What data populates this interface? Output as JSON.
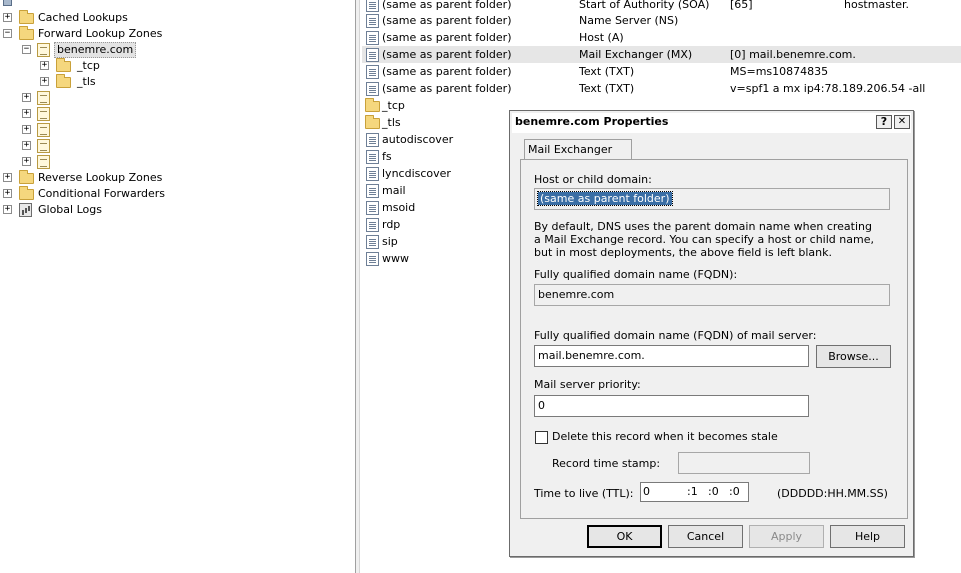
{
  "tree": {
    "cached": "Cached Lookups",
    "forward": "Forward Lookup Zones",
    "zone": "benemre.com",
    "tcp": "_tcp",
    "tls": "_tls",
    "reverse": "Reverse Lookup Zones",
    "conditional": "Conditional Forwarders",
    "global": "Global Logs",
    "plus": "+",
    "minus": "−"
  },
  "records": [
    {
      "name": "(same as parent folder)",
      "type": "Start of Authority (SOA)",
      "data": "[65]",
      "extra": "hostmaster."
    },
    {
      "name": "(same as parent folder)",
      "type": "Name Server (NS)",
      "data": "",
      "extra": ""
    },
    {
      "name": "(same as parent folder)",
      "type": "Host (A)",
      "data": "",
      "extra": ""
    },
    {
      "name": "(same as parent folder)",
      "type": "Mail Exchanger (MX)",
      "data": "[0]  mail.benemre.com.",
      "extra": ""
    },
    {
      "name": "(same as parent folder)",
      "type": "Text (TXT)",
      "data": "MS=ms10874835",
      "extra": ""
    },
    {
      "name": "(same as parent folder)",
      "type": "Text (TXT)",
      "data": "v=spf1 a mx ip4:78.189.206.54 -all",
      "extra": ""
    }
  ],
  "subitems": [
    "_tcp",
    "_tls",
    "autodiscover",
    "fs",
    "lyncdiscover",
    "mail",
    "msoid",
    "rdp",
    "sip",
    "www"
  ],
  "dialog": {
    "title": "benemre.com Properties",
    "help_btn": "?",
    "close_btn": "✕",
    "tab": "Mail Exchanger (MX)",
    "host_label": "Host or child domain:",
    "host_value": "(same as parent folder)",
    "desc": "By default, DNS uses the parent domain name when creating a Mail Exchange record. You can specify a host or child name, but in most deployments, the above field is left blank.",
    "fqdn_label": "Fully qualified domain name (FQDN):",
    "fqdn_value": "benemre.com",
    "mail_label": "Fully qualified domain name (FQDN) of mail server:",
    "mail_value": "mail.benemre.com.",
    "browse": "Browse...",
    "priority_label": "Mail server priority:",
    "priority_value": "0",
    "stale_label": "Delete this record when it becomes stale",
    "stamp_label": "Record time stamp:",
    "ttl_label": "Time to live (TTL):",
    "ttl_d": "0",
    "ttl_h": ":1",
    "ttl_m": ":0",
    "ttl_s": ":0",
    "ttl_format": "(DDDDD:HH.MM.SS)",
    "ok": "OK",
    "cancel": "Cancel",
    "apply": "Apply",
    "help": "Help"
  }
}
